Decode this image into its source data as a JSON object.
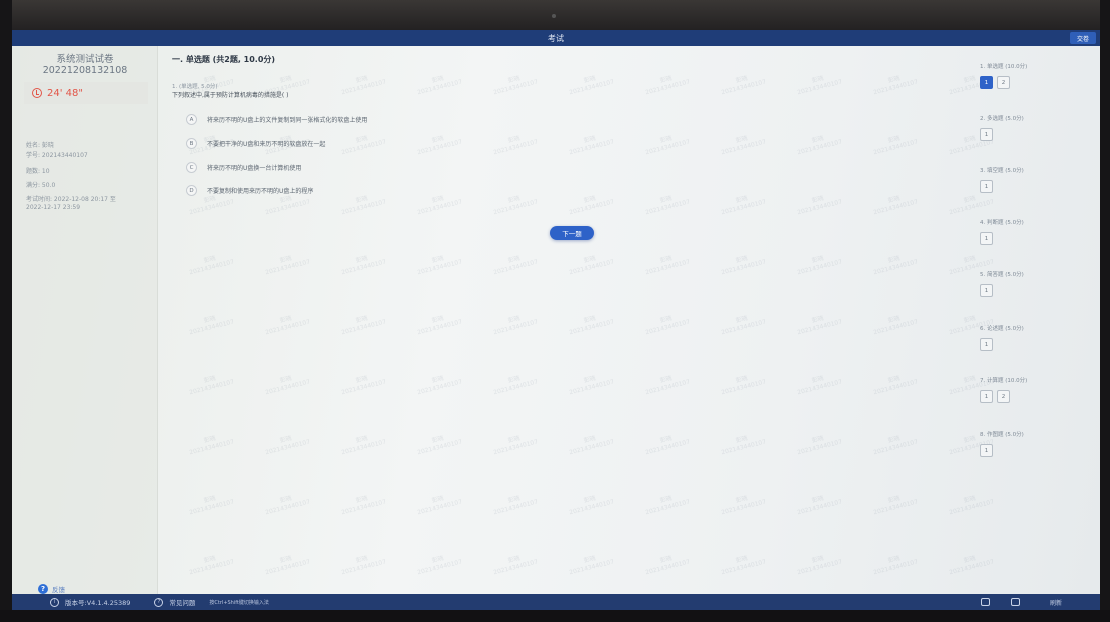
{
  "window": {
    "title": "考试",
    "submit_label": "交卷"
  },
  "left_panel": {
    "paper_title": "系统测试试卷",
    "paper_code": "20221208132108",
    "timer": "24' 48\"",
    "name_line": "姓名: 彭晓",
    "student_id_line": "学号: 202143440107",
    "question_count_line": "题数: 10",
    "full_score_line": "满分: 50.0",
    "exam_time_line_1": "考试时间: 2022-12-08 20:17 至",
    "exam_time_line_2": "2022-12-17 23:59",
    "feedback_label": "反馈"
  },
  "main": {
    "section_title": "一. 单选题 (共2题, 10.0分)",
    "question_meta": "1. (单选题, 5.0分)",
    "question_stem": "下列叙述中,属于预防计算机病毒的措施是( )",
    "options": [
      {
        "letter": "A",
        "text": "将来历不明的U盘上的文件复制到同一张格式化的软盘上使用"
      },
      {
        "letter": "B",
        "text": "不要把干净的U盘和来历不明的软盘放在一起"
      },
      {
        "letter": "C",
        "text": "将来历不明的U盘换一台计算机使用"
      },
      {
        "letter": "D",
        "text": "不要复制和使用来历不明的U盘上的程序"
      }
    ],
    "next_label": "下一题"
  },
  "watermark": {
    "line1": "彭晓",
    "line2": "202143440107"
  },
  "nav": {
    "sections": [
      {
        "label": "1. 单选题 (10.0分)",
        "items": [
          "1",
          "2"
        ],
        "active": 0
      },
      {
        "label": "2. 多选题 (5.0分)",
        "items": [
          "1"
        ],
        "active": -1
      },
      {
        "label": "3. 填空题 (5.0分)",
        "items": [
          "1"
        ],
        "active": -1
      },
      {
        "label": "4. 判断题 (5.0分)",
        "items": [
          "1"
        ],
        "active": -1
      },
      {
        "label": "5. 简答题 (5.0分)",
        "items": [
          "1"
        ],
        "active": -1
      },
      {
        "label": "6. 论述题 (5.0分)",
        "items": [
          "1"
        ],
        "active": -1
      },
      {
        "label": "7. 计算题 (10.0分)",
        "items": [
          "1",
          "2"
        ],
        "active": -1
      },
      {
        "label": "8. 作图题 (5.0分)",
        "items": [
          "1"
        ],
        "active": -1
      }
    ]
  },
  "statusbar": {
    "version": "版本号:V4.1.4.25389",
    "help_label": "常见问题",
    "input_hint": "按Ctrl+Shift键切换输入法",
    "refresh_label": "刷新"
  },
  "colors": {
    "accent": "#2e62c8",
    "titlebar": "#1f3d78",
    "timer": "#e25548"
  }
}
